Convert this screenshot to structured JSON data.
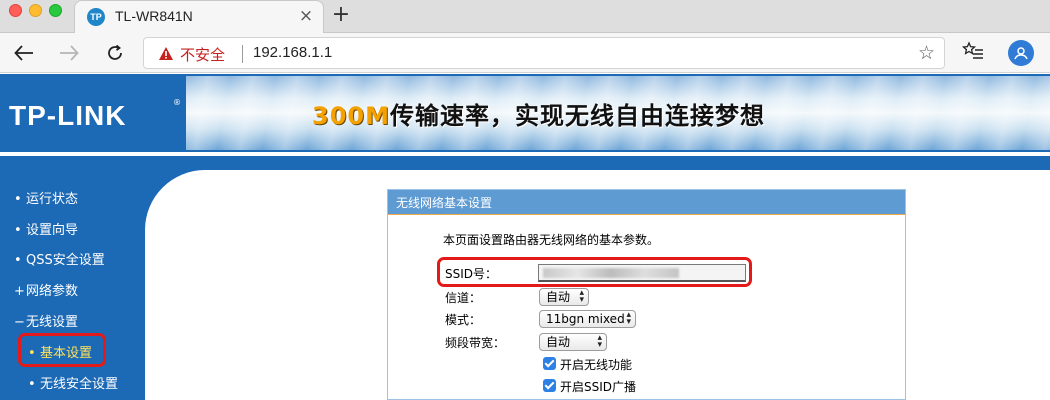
{
  "browser": {
    "tab": {
      "favicon_text": "TP",
      "title": "TL-WR841N"
    },
    "new_tab_symbol": "+",
    "address": {
      "security_label": "不安全",
      "url": "192.168.1.1"
    },
    "icons": [
      "back-arrow-icon",
      "forward-arrow-icon",
      "reload-icon",
      "warning-icon",
      "star-icon",
      "favorites-icon",
      "profile-icon"
    ]
  },
  "banner": {
    "logo": "TP-LINK",
    "logo_reg": "®",
    "slogan_highlight": "300M",
    "slogan_rest": "传输速率，实现无线自由连接梦想"
  },
  "menu": {
    "items": [
      {
        "bullet": "•",
        "label": "运行状态"
      },
      {
        "bullet": "•",
        "label": "设置向导"
      },
      {
        "bullet": "•",
        "label": "QSS安全设置"
      },
      {
        "bullet": "+",
        "label": "网络参数"
      },
      {
        "bullet": "−",
        "label": "无线设置"
      }
    ],
    "subitems": [
      {
        "bullet": "•",
        "label": "基本设置",
        "active": true
      },
      {
        "bullet": "•",
        "label": "无线安全设置"
      }
    ]
  },
  "panel": {
    "title": "无线网络基本设置",
    "description": "本页面设置路由器无线网络的基本参数。",
    "fields": {
      "ssid_label": "SSID号：",
      "channel_label": "信道：",
      "channel_value": "自动",
      "mode_label": "模式：",
      "mode_value": "11bgn mixed",
      "bandwidth_label": "频段带宽：",
      "bandwidth_value": "自动"
    },
    "checkboxes": [
      {
        "label": "开启无线功能",
        "checked": true
      },
      {
        "label": "开启SSID广播",
        "checked": true
      }
    ]
  },
  "colors": {
    "router_blue": "#1c69b6",
    "panel_header": "#5e9bd3",
    "highlight_red": "#e31a1a",
    "menu_active": "#ffe35a"
  }
}
